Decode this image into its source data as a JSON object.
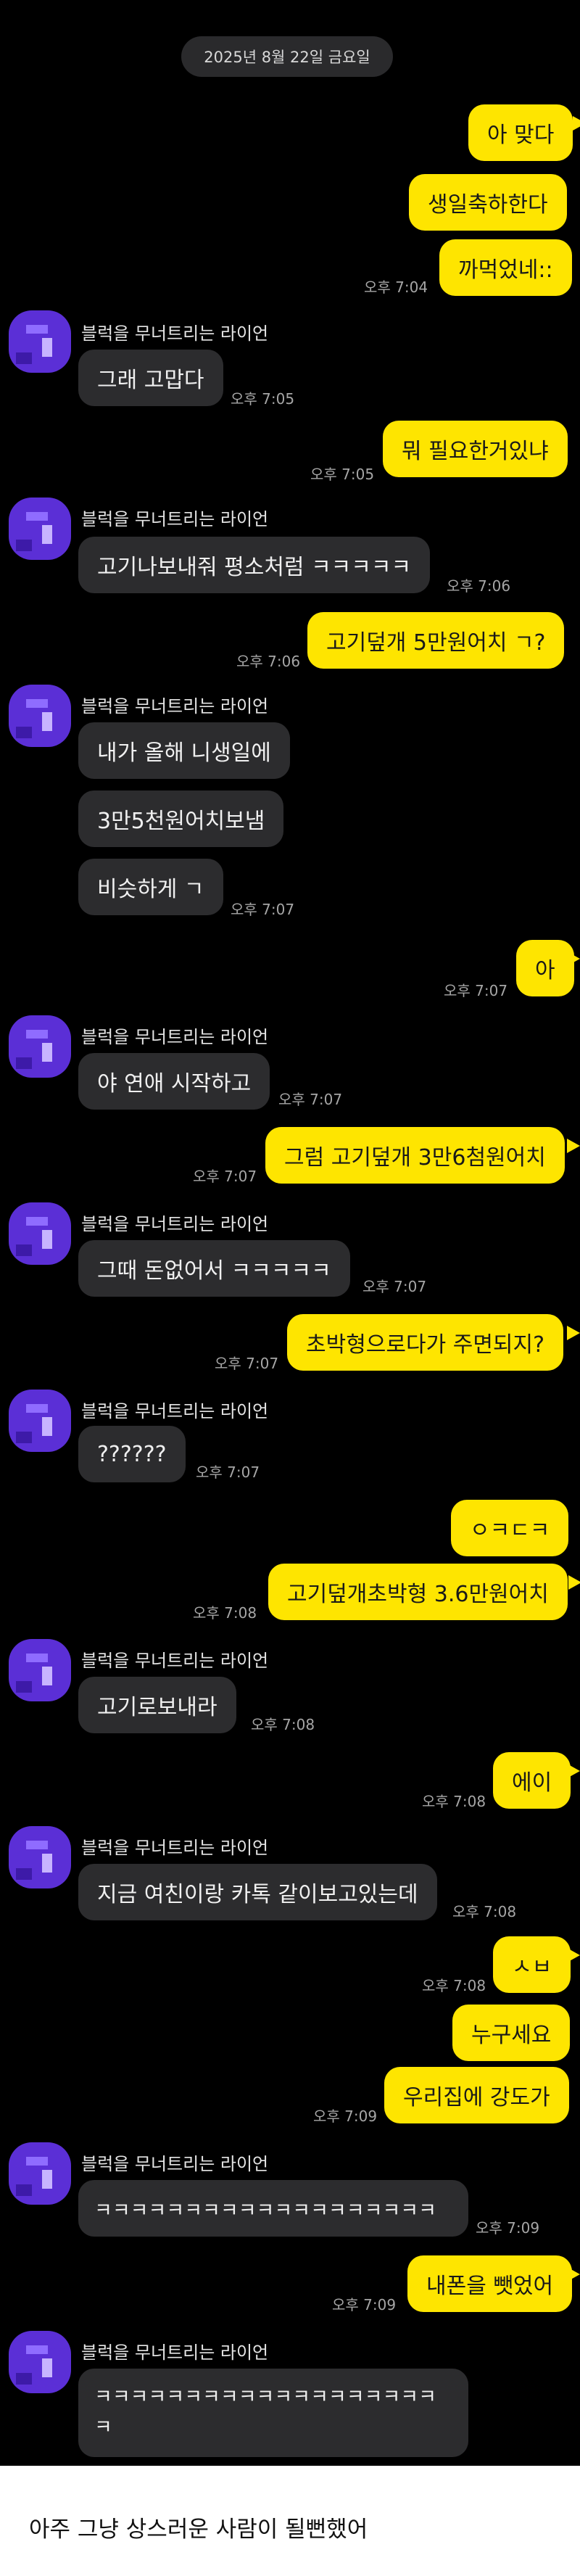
{
  "date_divider": "2025년 8월 22일 금요일",
  "sender_name": "블럭을 무너트리는 라이언",
  "messages": {
    "m1": "아 맞다",
    "m2": "생일축하한다",
    "m3": "까먹었네::",
    "t3": "오후 7:04",
    "m4": "그래 고맙다",
    "t4": "오후 7:05",
    "m5": "뭐 필요한거있냐",
    "t5": "오후 7:05",
    "m6": "고기나보내줘 평소처럼 ㅋㅋㅋㅋㅋ",
    "t6": "오후 7:06",
    "m7": "고기덮개 5만원어치 ㄱ?",
    "t7": "오후 7:06",
    "m8": "내가 올해 니생일에",
    "m9": "3만5천원어치보냄",
    "m10": "비슷하게 ㄱ",
    "t10": "오후 7:07",
    "m11": "아",
    "t11": "오후 7:07",
    "m12": "야 연애 시작하고",
    "t12": "오후 7:07",
    "m13": "그럼 고기덮개 3만6첨원어치",
    "t13": "오후 7:07",
    "m14": "그때 돈없어서 ㅋㅋㅋㅋㅋ",
    "t14": "오후 7:07",
    "m15": "초박형으로다가 주면되지?",
    "t15": "오후 7:07",
    "m16": "??????",
    "t16": "오후 7:07",
    "m17": "ㅇㅋㄷㅋ",
    "m18": "고기덮개초박형 3.6만원어치",
    "t18": "오후 7:08",
    "m19": "고기로보내라",
    "t19": "오후 7:08",
    "m20": "에이",
    "t20": "오후 7:08",
    "m21": "지금 여친이랑 카톡 같이보고있는데",
    "t21": "오후 7:08",
    "m22": "ㅅㅂ",
    "t22": "오후 7:08",
    "m23": "누구세요",
    "m24": "우리집에 강도가",
    "t24": "오후 7:09",
    "m25": "ㅋㅋㅋㅋㅋㅋㅋㅋㅋㅋㅋㅋㅋㅋㅋㅋㅋㅋㅋ",
    "t25": "오후 7:09",
    "m26": "내폰을 뺏었어",
    "t26": "오후 7:09",
    "m27a": "ㅋㅋㅋㅋㅋㅋㅋㅋㅋㅋㅋㅋㅋㅋㅋㅋㅋㅋㅋ",
    "m27b": "ㅋ"
  },
  "caption": "아주 그냥 상스러운 사람이 될뻔했어",
  "colors": {
    "background": "#000000",
    "my_bubble": "#fee500",
    "their_bubble": "#2c2c2e",
    "avatar": "#5b2fd6",
    "caption_background": "#ffffff"
  },
  "icons": {
    "avatar": "pixel-art-avatar-icon"
  }
}
